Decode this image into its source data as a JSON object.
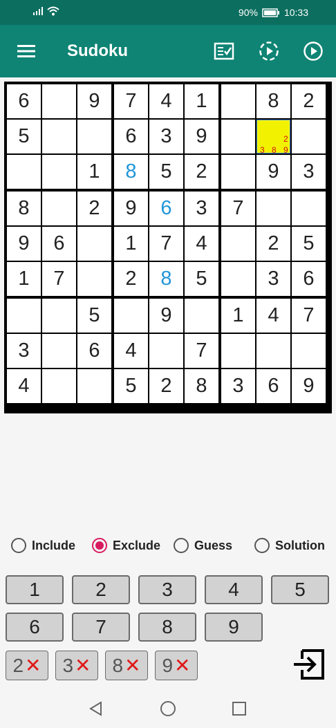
{
  "status_bar": {
    "battery": "90%",
    "time": "10:33"
  },
  "app_bar": {
    "title": "Sudoku",
    "icons": [
      "menu-icon",
      "checklist-icon",
      "partial-play-icon",
      "play-icon"
    ]
  },
  "board": {
    "rows": [
      [
        "6",
        "",
        "9",
        "7",
        "4",
        "1",
        "",
        "8",
        "2"
      ],
      [
        "5",
        "",
        "",
        "6",
        "3",
        "9",
        "",
        "",
        ""
      ],
      [
        "",
        "",
        "1",
        "8",
        "5",
        "2",
        "",
        "9",
        "3"
      ],
      [
        "8",
        "",
        "2",
        "9",
        "6",
        "3",
        "7",
        "",
        ""
      ],
      [
        "9",
        "6",
        "",
        "1",
        "7",
        "4",
        "",
        "2",
        "5"
      ],
      [
        "1",
        "7",
        "",
        "2",
        "8",
        "5",
        "",
        "3",
        "6"
      ],
      [
        "",
        "",
        "5",
        "",
        "9",
        "",
        "1",
        "4",
        "7"
      ],
      [
        "3",
        "",
        "6",
        "4",
        "",
        "7",
        "",
        "",
        ""
      ],
      [
        "4",
        "",
        "",
        "5",
        "2",
        "8",
        "3",
        "6",
        "9"
      ]
    ],
    "blue_cells": [
      "2-3",
      "3-4",
      "5-4"
    ],
    "selected_cell": {
      "row": 1,
      "col": 7,
      "candidates": [
        "2",
        "3",
        "8",
        "9"
      ]
    },
    "colors": {
      "given": "#222222",
      "entered": "#2196d8",
      "selected_bg": "#f2f200",
      "candidate": "#d01010"
    }
  },
  "modes": [
    {
      "label": "Include",
      "selected": false
    },
    {
      "label": "Exclude",
      "selected": true
    },
    {
      "label": "Guess",
      "selected": false
    },
    {
      "label": "Solution",
      "selected": false
    }
  ],
  "number_buttons": [
    "1",
    "2",
    "3",
    "4",
    "5",
    "6",
    "7",
    "8",
    "9"
  ],
  "excluded_buttons": [
    {
      "digit": "2",
      "mark": "✕"
    },
    {
      "digit": "3",
      "mark": "✕"
    },
    {
      "digit": "8",
      "mark": "✕"
    },
    {
      "digit": "9",
      "mark": "✕"
    }
  ],
  "colors": {
    "status_bar": "#0c6e5f",
    "app_bar": "#0f8474",
    "radio_accent": "#d81b60"
  }
}
